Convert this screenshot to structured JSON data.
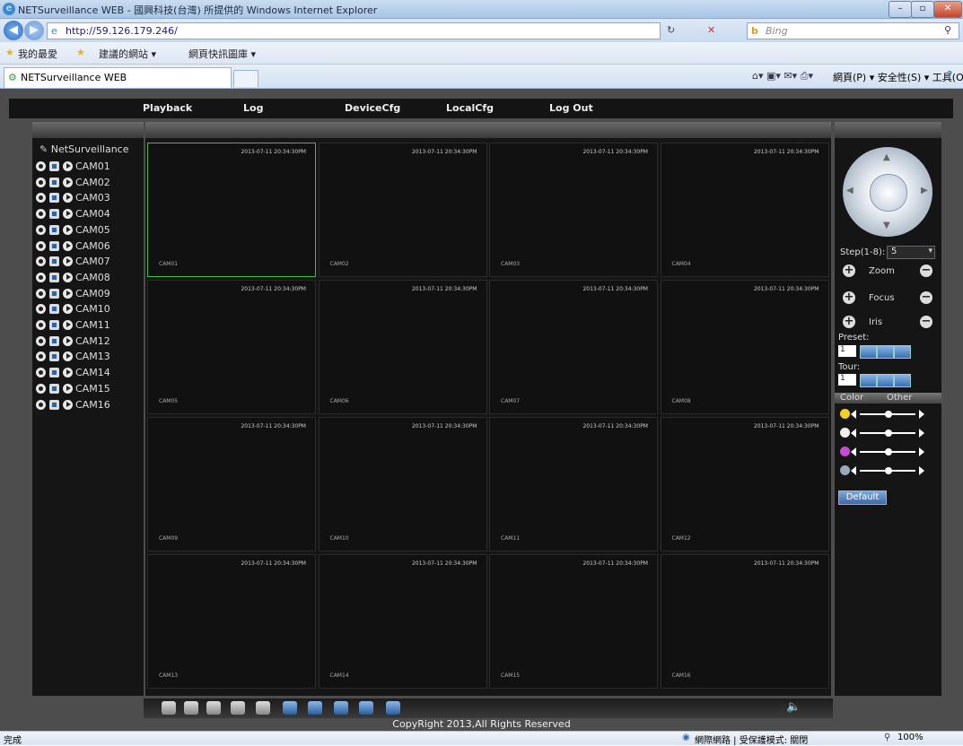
{
  "browser": {
    "title": "NETSurveillance WEB - 國興科技(台灣) 所提供的 Windows Internet Explorer",
    "url": "http://59.126.179.246/",
    "search_placeholder": "Bing",
    "favorites": [
      "我的最愛",
      "建議的網站 ▾",
      "網頁快訊圖庫 ▾"
    ],
    "tab_title": "NETSurveillance WEB",
    "commands": "網頁(P) ▾  安全性(S) ▾  工具(O) ▾",
    "status_left": "完成",
    "status_zone": "網際網路 | 受保護模式: 關閉",
    "zoom": "100%"
  },
  "nav": {
    "items": [
      "Playback",
      "Log",
      "DeviceCfg",
      "LocalCfg",
      "Log Out"
    ]
  },
  "sidebar": {
    "root": "NetSurveillance",
    "cameras": [
      "CAM01",
      "CAM02",
      "CAM03",
      "CAM04",
      "CAM05",
      "CAM06",
      "CAM07",
      "CAM08",
      "CAM09",
      "CAM10",
      "CAM11",
      "CAM12",
      "CAM13",
      "CAM14",
      "CAM15",
      "CAM16"
    ]
  },
  "grid": {
    "timestamp": "2013-07-11 20:34:30PM",
    "tiles": [
      "CAM01",
      "CAM02",
      "CAM03",
      "CAM04",
      "CAM05",
      "CAM06",
      "CAM07",
      "CAM08",
      "CAM09",
      "CAM10",
      "CAM11",
      "CAM12",
      "CAM13",
      "CAM14",
      "CAM15",
      "CAM16"
    ]
  },
  "ptz": {
    "step_label": "Step(1-8):",
    "step_value": "5",
    "zoom": "Zoom",
    "focus": "Focus",
    "iris": "Iris",
    "preset_label": "Preset:",
    "preset_value": "1",
    "tour_label": "Tour:",
    "tour_value": "1",
    "tab_color": "Color",
    "tab_other": "Other",
    "default_label": "Default",
    "slider_levels": [
      0.5,
      0.5,
      0.5,
      0.5
    ]
  },
  "footer": {
    "copyright": "CopyRight 2013,All Rights Reserved"
  },
  "colors": {
    "selected_border": "#3fbf3f",
    "accent": "#2a63b0"
  }
}
